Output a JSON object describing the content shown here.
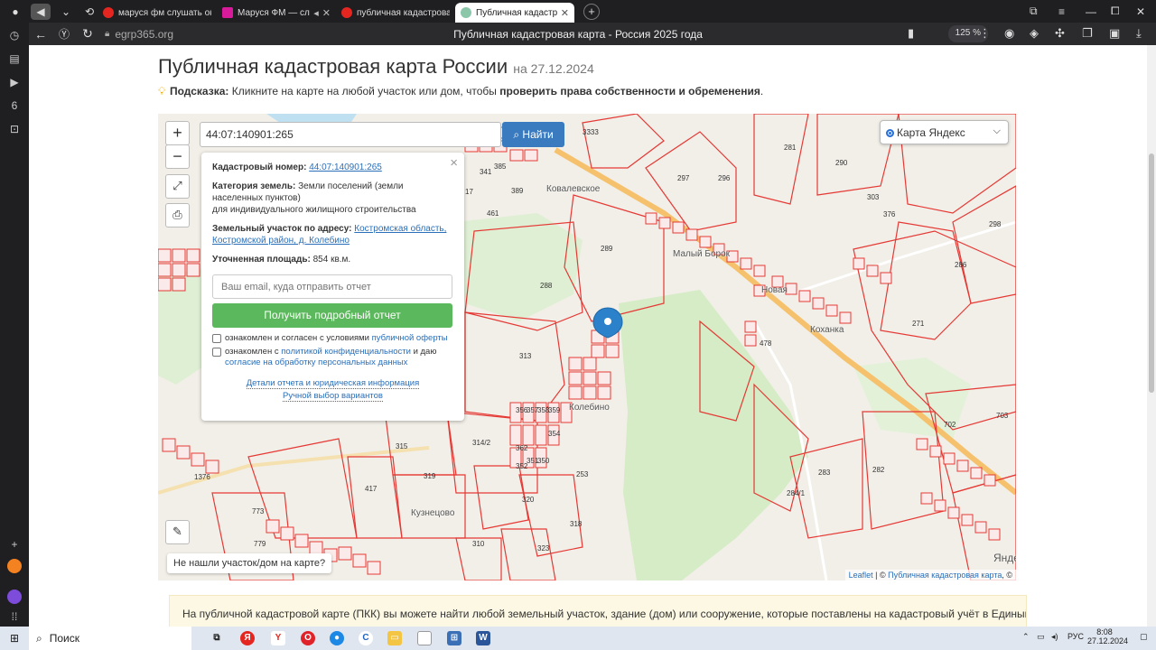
{
  "browser": {
    "tabs": [
      {
        "label": "маруся фм слушать онла",
        "color": "#e52620",
        "active": false
      },
      {
        "label": "Маруся ФМ — слуш",
        "color": "#d81b9a",
        "active": false
      },
      {
        "label": "публичная кадастровая к",
        "color": "#e52620",
        "active": false
      },
      {
        "label": "Публичная кадастрова",
        "color": "#8bc7a8",
        "active": true
      }
    ],
    "url": "egrp365.org",
    "page_title": "Публичная кадастровая карта - Россия 2025 года",
    "zoom": "125 %"
  },
  "page": {
    "heading": "Публичная кадастровая карта России",
    "heading_date": "на 27.12.2024",
    "hint_label": "Подсказка:",
    "hint_text": "Кликните на карте на любой участок или дом, чтобы",
    "hint_bold": "проверить права собственности и обременения",
    "hint_end": "."
  },
  "map": {
    "zoom_in": "+",
    "zoom_out": "−",
    "search_value": "44:07:140901:265",
    "find_button": "Найти",
    "layer_select": "Карта Яндекс",
    "not_found": "Не нашли участок/дом на карте?",
    "attribution_leaflet": "Leaflet",
    "attribution_sep": " | © ",
    "attribution_pkk": "Публичная кадастровая карта",
    "attribution_end": ", ©",
    "place_labels": [
      "Ковалевское",
      "Малый Борок",
      "Новая",
      "Кузнецово",
      "Колебино",
      "Коханка",
      "Кузнецово",
      "Яндекс"
    ],
    "parcel_labels": [
      "3333",
      "281",
      "290",
      "296",
      "297",
      "303",
      "298",
      "286",
      "289",
      "288",
      "271",
      "313",
      "314/2",
      "315",
      "319",
      "417",
      "773",
      "779",
      "320",
      "318",
      "323",
      "310",
      "253",
      "284/1",
      "282",
      "283",
      "702",
      "703",
      "461",
      "389",
      "341",
      "385",
      "17",
      "376",
      "478",
      "1376",
      "356",
      "357",
      "358",
      "362",
      "359",
      "352",
      "351",
      "350",
      "354"
    ]
  },
  "popup": {
    "cad_label": "Кадастровый номер:",
    "cad_value": "44:07:140901:265",
    "cat_label": "Категория земель:",
    "cat_value": "Земли поселений (земли населенных пунктов)",
    "cat_use": "для индивидуального жилищного строительства",
    "addr_label": "Земельный участок по адресу:",
    "addr_value": "Костромская область, Костромской район, д. Колебино",
    "area_label": "Уточненная площадь:",
    "area_value": "854 кв.м.",
    "email_placeholder": "Ваш email, куда отправить отчет",
    "report_button": "Получить подробный отчет",
    "chk1_text": "ознакомлен и согласен с условиями",
    "chk1_link": "публичной оферты",
    "chk2_text": "ознакомлен с",
    "chk2_link": "политикой конфиденциальности",
    "chk2_mid": "и даю",
    "chk2_link2": "согласие на обработку персональных данных",
    "link_details": "Детали отчета и юридическая информация",
    "link_manual": "Ручной выбор вариантов",
    "close": "×"
  },
  "info": {
    "text": "На публичной кадастровой карте (ПКК) вы можете найти любой земельный участок, здание (дом) или сооружение, которые поставлены на кадастровый учёт в Единый"
  },
  "taskbar": {
    "search": "Поиск",
    "lang": "РУС",
    "time": "8:08",
    "date": "27.12.2024"
  },
  "colors": {
    "parcel_line": "#e53935",
    "road": "#f5c16c",
    "forest": "#d5ecc6",
    "accent_blue": "#3a7abf",
    "report_green": "#5cb85c"
  },
  "icons": [
    "user-icon",
    "sound-icon",
    "chevron-down-icon",
    "back-icon",
    "yandex-icon",
    "reload-icon",
    "lock-icon",
    "bookmark-icon",
    "search-icon",
    "fullscreen-icon",
    "print-icon",
    "ruler-icon",
    "map-pin-icon"
  ]
}
